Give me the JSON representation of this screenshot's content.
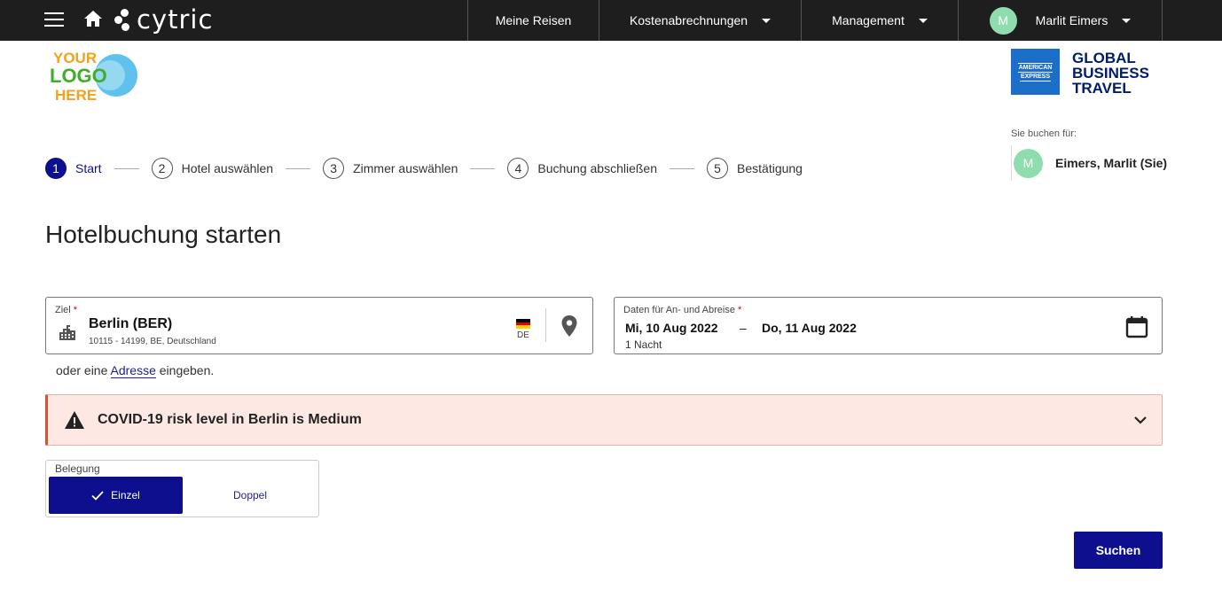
{
  "topnav": {
    "brand": "cytric",
    "items": [
      {
        "label": "Meine Reisen"
      },
      {
        "label": "Kostenabrechnungen"
      },
      {
        "label": "Management"
      }
    ],
    "user": {
      "initial": "M",
      "name": "Marlit Eimers"
    }
  },
  "logos": {
    "your_logo": [
      "YOUR",
      "LOGO",
      "HERE"
    ],
    "amex_box": [
      "AMERICAN",
      "EXPRESS"
    ],
    "amex_text": [
      "GLOBAL",
      "BUSINESS",
      "TRAVEL"
    ]
  },
  "booking_for": {
    "label": "Sie buchen für:",
    "initial": "M",
    "name": "Eimers, Marlit (Sie)"
  },
  "stepper": [
    {
      "num": "1",
      "label": "Start",
      "active": true
    },
    {
      "num": "2",
      "label": "Hotel auswählen"
    },
    {
      "num": "3",
      "label": "Zimmer auswählen"
    },
    {
      "num": "4",
      "label": "Buchung abschließen"
    },
    {
      "num": "5",
      "label": "Bestätigung"
    }
  ],
  "page_title": "Hotelbuchung starten",
  "destination": {
    "label": "Ziel",
    "required": "*",
    "value": "Berlin (BER)",
    "sub": "10115 - 14199, BE, Deutschland",
    "country_code": "DE"
  },
  "dates": {
    "label": "Daten für An- und Abreise",
    "required": "*",
    "from": "Mi, 10 Aug 2022",
    "separator": "–",
    "to": "Do, 11 Aug 2022",
    "nights": "1 Nacht"
  },
  "address_hint": {
    "prefix": "oder eine",
    "link": "Adresse",
    "suffix": "eingeben."
  },
  "covid": {
    "text": "COVID-19 risk level in Berlin is Medium"
  },
  "occupancy": {
    "label": "Belegung",
    "single": "Einzel",
    "double": "Doppel"
  },
  "search_button": "Suchen",
  "colors": {
    "primary": "#0d0f8f",
    "nav_bg": "#1e1e1e",
    "avatar": "#8fdcae",
    "covid_bg": "#fde8e4",
    "covid_accent": "#d9522e"
  }
}
